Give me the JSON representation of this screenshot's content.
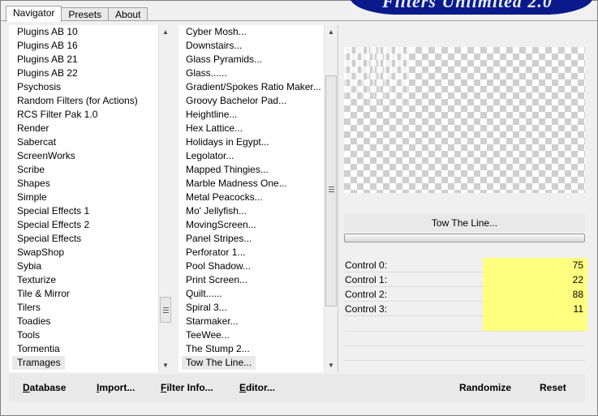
{
  "tabs": [
    {
      "label": "Navigator"
    },
    {
      "label": "Presets"
    },
    {
      "label": "About"
    }
  ],
  "banner_text": "Filters Unlimited 2.0",
  "categories": [
    "Plugins AB 10",
    "Plugins AB 16",
    "Plugins AB 21",
    "Plugins AB 22",
    "Psychosis",
    "Random Filters (for Actions)",
    "RCS Filter Pak 1.0",
    "Render",
    "Sabercat",
    "ScreenWorks",
    "Scribe",
    "Shapes",
    "Simple",
    "Special Effects 1",
    "Special Effects 2",
    "Special Effects",
    "SwapShop",
    "Sybia",
    "Texturize",
    "Tile & Mirror",
    "Tilers",
    "Toadies",
    "Tools",
    "Tormentia",
    "Tramages"
  ],
  "filters": [
    "Cyber Mosh...",
    "Downstairs...",
    "Glass Pyramids...",
    "Glass......",
    "Gradient/Spokes Ratio Maker...",
    "Groovy Bachelor Pad...",
    "Heightline...",
    "Hex Lattice...",
    "Holidays in Egypt...",
    "Legolator...",
    "Mapped Thingies...",
    "Marble Madness One...",
    "Metal Peacocks...",
    "Mo' Jellyfish...",
    "MovingScreen...",
    "Panel Stripes...",
    "Perforator 1...",
    "Pool Shadow...",
    "Print Screen...",
    "Quilt......",
    "Spiral 3...",
    "Starmaker...",
    "TeeWee...",
    "The Stump 2...",
    "Tow The Line..."
  ],
  "selected_filter_name": "Tow The Line...",
  "controls": [
    {
      "label": "Control 0:",
      "value": "75"
    },
    {
      "label": "Control 1:",
      "value": "22"
    },
    {
      "label": "Control 2:",
      "value": "88"
    },
    {
      "label": "Control 3:",
      "value": "11"
    }
  ],
  "buttons": {
    "database": {
      "first": "D",
      "rest": "atabase"
    },
    "import": {
      "first": "I",
      "rest": "mport..."
    },
    "filter_info": {
      "first": "F",
      "rest": "ilter Info..."
    },
    "editor": {
      "first": "E",
      "rest": "ditor..."
    },
    "randomize": "Randomize",
    "reset": "Reset"
  },
  "colors": {
    "control_value_bg": "#ffff80",
    "banner_bg": "#0a1a8a",
    "window_bg": "#f0f0f0"
  }
}
